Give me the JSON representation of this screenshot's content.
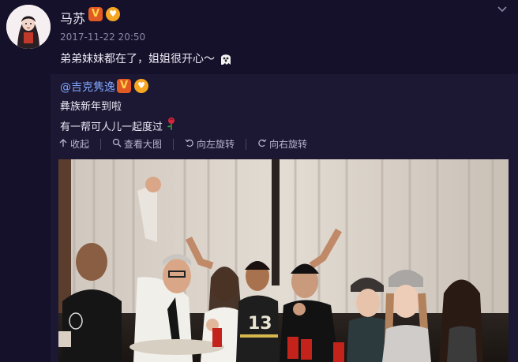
{
  "post": {
    "username": "马苏",
    "timestamp": "2017-11-22 20:50",
    "text": "弟弟妹妹都在了，姐姐很开心～"
  },
  "repost": {
    "username": "@吉克隽逸",
    "line1": "彝族新年到啦",
    "line2": "有一帮可人儿一起度过"
  },
  "toolbar": {
    "collapse": "收起",
    "view_large": "查看大图",
    "rotate_left": "向左旋转",
    "rotate_right": "向右旋转"
  },
  "icons": {
    "verified": "verified-v-badge",
    "member": "member-badge",
    "ghost": "ghost-emoji",
    "rose": "rose-emoji",
    "chevron": "chevron-down-icon"
  },
  "colors": {
    "background": "#15112a",
    "repost_bg": "#1c1833",
    "link": "#7fa6ff",
    "muted": "#8c86a6"
  }
}
